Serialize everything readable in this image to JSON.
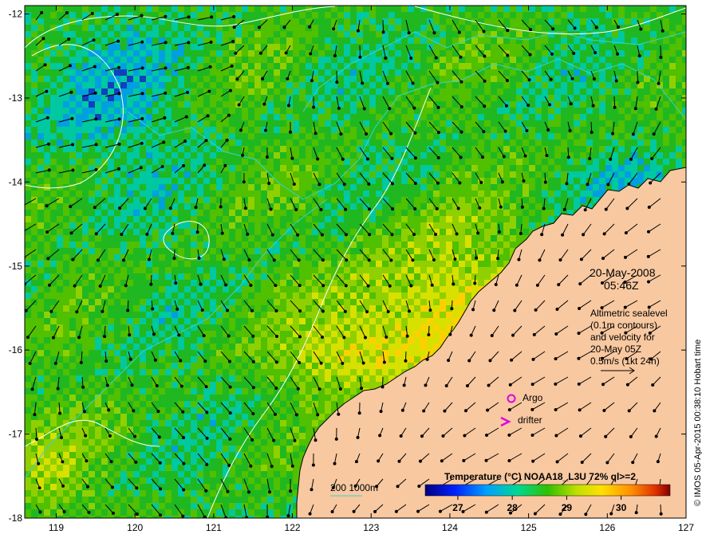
{
  "map": {
    "lon_range": [
      118.6,
      127.0
    ],
    "lat_range": [
      -18.0,
      -11.9
    ],
    "lon_ticks": [
      "119",
      "120",
      "121",
      "122",
      "123",
      "124",
      "125",
      "126",
      "127"
    ],
    "lat_ticks": [
      "-12",
      "-13",
      "-14",
      "-15",
      "-16",
      "-17",
      "-18"
    ],
    "date_label": "20-May-2008",
    "time_label": "05:46Z",
    "altimetry_text": [
      "Altimetric sealevel",
      "(0.1m contours)",
      "and velocity for",
      "20-May 05Z",
      "0.5m/s (1kt 24h)"
    ],
    "legend_argo": "Argo",
    "legend_drifter": "drifter",
    "bathy_label": "200  1000m",
    "credit": "© IMOS 05-Apr-2015 00:38:10 Hobart time",
    "colorbar": {
      "title": "Temperature (°C) NOAA18_L3U 72% ql>=2",
      "ticks": [
        "27",
        "28",
        "29",
        "30"
      ],
      "range": [
        26.4,
        30.9
      ]
    },
    "colors": {
      "land": "#f8c8a0",
      "argo": "#e000e0",
      "drifter": "#e000e0",
      "isobath": "#33d4d4",
      "contour": "#ffffff"
    }
  }
}
